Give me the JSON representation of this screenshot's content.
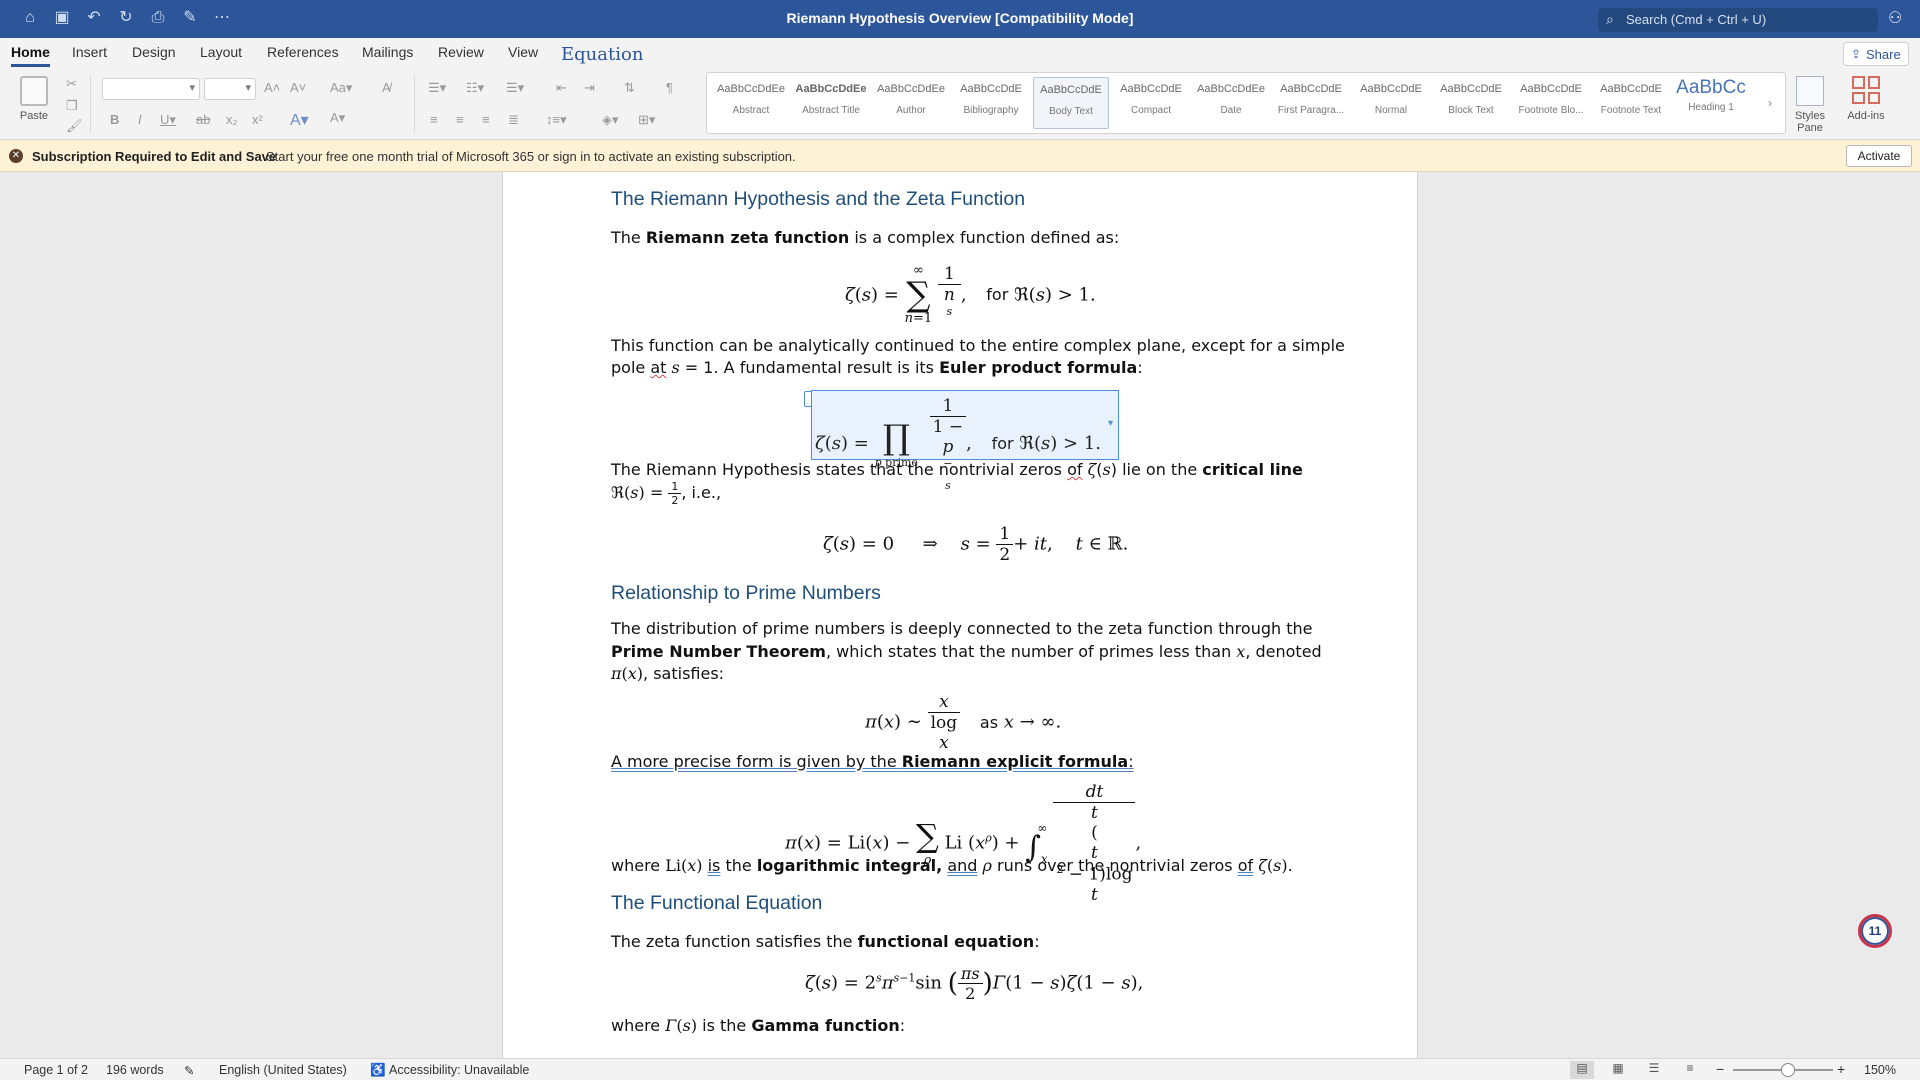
{
  "window": {
    "title": "Riemann Hypothesis Overview [Compatibility Mode]",
    "search_placeholder": "Search (Cmd + Ctrl + U)"
  },
  "tabs": [
    "Home",
    "Insert",
    "Design",
    "Layout",
    "References",
    "Mailings",
    "Review",
    "View",
    "Equation"
  ],
  "share_label": "Share",
  "ribbon": {
    "paste_label": "Paste",
    "styles": [
      {
        "sample": "AaBbCcDdEe",
        "name": "Abstract"
      },
      {
        "sample": "AaBbCcDdEe",
        "name": "Abstract Title"
      },
      {
        "sample": "AaBbCcDdEe",
        "name": "Author"
      },
      {
        "sample": "AaBbCcDdE",
        "name": "Bibliography"
      },
      {
        "sample": "AaBbCcDdE",
        "name": "Body Text"
      },
      {
        "sample": "AaBbCcDdE",
        "name": "Compact"
      },
      {
        "sample": "AaBbCcDdEe",
        "name": "Date"
      },
      {
        "sample": "AaBbCcDdE",
        "name": "First Paragra..."
      },
      {
        "sample": "AaBbCcDdE",
        "name": "Normal"
      },
      {
        "sample": "AaBbCcDdE",
        "name": "Block Text"
      },
      {
        "sample": "AaBbCcDdE",
        "name": "Footnote Blo..."
      },
      {
        "sample": "AaBbCcDdE",
        "name": "Footnote Text"
      },
      {
        "sample": "AaBbCc",
        "name": "Heading 1"
      }
    ],
    "styles_pane_label": "Styles Pane",
    "addins_label": "Add-ins"
  },
  "notice": {
    "title": "Subscription Required to Edit and Save",
    "message": "Start your free one month trial of Microsoft 365 or sign in to activate an existing subscription.",
    "button": "Activate"
  },
  "doc": {
    "h1": "The Riemann Hypothesis and the Zeta Function",
    "p1_a": "The ",
    "p1_b": "Riemann zeta function",
    "p1_c": " is a complex function defined as:",
    "p2_line1": "This function can be analytically continued to the entire complex plane, except for a simple",
    "p2_a": "pole ",
    "p2_at": "at",
    "p2_b": ". A fundamental result is its ",
    "p2_bold": "Euler product formula",
    "p3_a": "The Riemann Hypothesis states that the nontrivial zeros ",
    "p3_of": "of",
    "p3_b": " lie on the ",
    "p3_bold": "critical line",
    "p3_c": ", i.e.,",
    "h2": "Relationship to Prime Numbers",
    "p4_a": "The distribution of prime numbers is deeply connected to the zeta function through the",
    "p4_bold": "Prime Number Theorem",
    "p4_b": ", which states that the number of primes less than ",
    "p4_c": ", denoted",
    "p4_d": ", satisfies:",
    "p5_a": "A more precise form is given by the ",
    "p5_bold": "Riemann explicit formula",
    "p6_a": "where ",
    "p6_is": "is",
    "p6_b": " the ",
    "p6_bold": "logarithmic integral,",
    "p6_and": "and",
    "p6_c": " runs over the nontrivial zeros ",
    "p6_of": "of",
    "h3": "The Functional Equation",
    "p7_a": "The zeta function satisfies the ",
    "p7_bold": "functional equation",
    "p8_a": "where ",
    "p8_b": " is the ",
    "p8_bold": "Gamma function"
  },
  "badge_count": "11",
  "status": {
    "page": "Page 1 of 2",
    "words": "196 words",
    "language": "English (United States)",
    "accessibility": "Accessibility: Unavailable",
    "zoom": "150%"
  }
}
